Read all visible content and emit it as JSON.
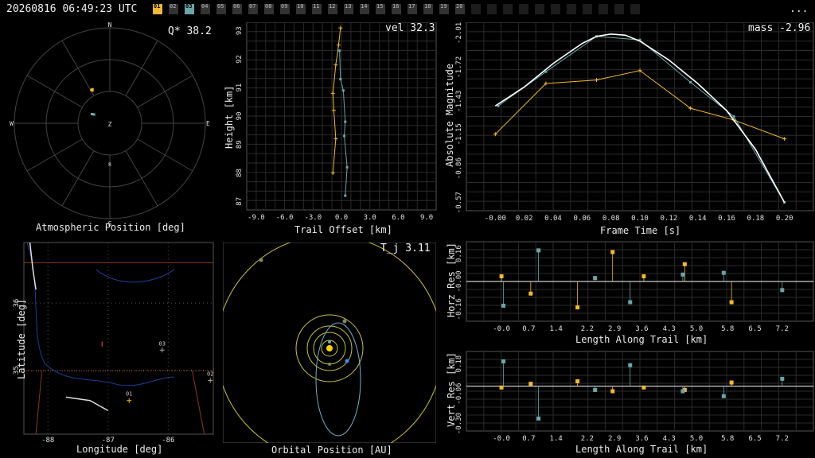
{
  "header": {
    "timestamp": "20260816 06:49:23 UTC",
    "more_label": "...",
    "stations": [
      {
        "id": "01",
        "color": "#f5b82e",
        "active": true
      },
      {
        "id": "02",
        "color": "#3a3a3a",
        "active": false
      },
      {
        "id": "03",
        "color": "#6aa6a8",
        "active": true
      },
      {
        "id": "04",
        "color": "#3a3a3a",
        "active": false
      },
      {
        "id": "05",
        "color": "#3a3a3a",
        "active": false
      },
      {
        "id": "06",
        "color": "#3a3a3a",
        "active": false
      },
      {
        "id": "07",
        "color": "#3a3a3a",
        "active": false
      },
      {
        "id": "08",
        "color": "#3a3a3a",
        "active": false
      },
      {
        "id": "09",
        "color": "#3a3a3a",
        "active": false
      },
      {
        "id": "10",
        "color": "#3a3a3a",
        "active": false
      },
      {
        "id": "11",
        "color": "#3a3a3a",
        "active": false
      },
      {
        "id": "12",
        "color": "#3a3a3a",
        "active": false
      },
      {
        "id": "13",
        "color": "#3a3a3a",
        "active": false
      },
      {
        "id": "14",
        "color": "#3a3a3a",
        "active": false
      },
      {
        "id": "15",
        "color": "#3a3a3a",
        "active": false
      },
      {
        "id": "16",
        "color": "#3a3a3a",
        "active": false
      },
      {
        "id": "17",
        "color": "#3a3a3a",
        "active": false
      },
      {
        "id": "18",
        "color": "#3a3a3a",
        "active": false
      },
      {
        "id": "19",
        "color": "#3a3a3a",
        "active": false
      },
      {
        "id": "20",
        "color": "#3a3a3a",
        "active": false
      },
      {
        "id": "",
        "color": "#1c1c1c",
        "active": false
      },
      {
        "id": "",
        "color": "#1c1c1c",
        "active": false
      },
      {
        "id": "",
        "color": "#1c1c1c",
        "active": false
      },
      {
        "id": "",
        "color": "#1c1c1c",
        "active": false
      },
      {
        "id": "",
        "color": "#1c1c1c",
        "active": false
      },
      {
        "id": "",
        "color": "#1c1c1c",
        "active": false
      },
      {
        "id": "",
        "color": "#1c1c1c",
        "active": false
      },
      {
        "id": "",
        "color": "#1c1c1c",
        "active": false
      },
      {
        "id": "",
        "color": "#1c1c1c",
        "active": false
      },
      {
        "id": "",
        "color": "#1c1c1c",
        "active": false
      },
      {
        "id": "",
        "color": "#1c1c1c",
        "active": false
      }
    ]
  },
  "colors": {
    "station1": "#f5b82e",
    "station2": "#6aa6a8",
    "fit": "#ffffff",
    "grid": "#2b2b2b",
    "orbit": "#c8c23a",
    "sun": "#ffd400",
    "earth": "#3a8cff",
    "comet_orbit": "#6fb3c9"
  },
  "chart_data": [
    {
      "type": "scatter",
      "name": "atmospheric_position",
      "title": "Atmospheric Position [deg]",
      "readout": "Q* 38.2",
      "compass": {
        "n": "N",
        "s": "S",
        "e": "E",
        "w": "W",
        "z": "Z",
        "r": "R"
      },
      "series": [
        {
          "station": "01",
          "points": [
            [
              -28,
              55
            ],
            [
              -29,
              54
            ],
            [
              -27,
              54
            ]
          ]
        },
        {
          "station": "03",
          "points": [
            [
              -62,
              72
            ],
            [
              -63,
              71
            ],
            [
              -61,
              73
            ]
          ]
        }
      ]
    },
    {
      "type": "line",
      "name": "trail",
      "title": "",
      "readout": "vel 32.3",
      "xlabel": "Trail Offset [km]",
      "ylabel": "Height [km]",
      "xlim": [
        -10,
        10
      ],
      "ylim": [
        86.7,
        93.3
      ],
      "xticks": [
        "-9.0",
        "-6.0",
        "-3.0",
        "0.0",
        "3.0",
        "6.0",
        "9.0"
      ],
      "yticks": [
        "87",
        "88",
        "89",
        "90",
        "91",
        "92",
        "93"
      ],
      "series": [
        {
          "station": "01",
          "x": [
            -0.1,
            -0.3,
            -0.6,
            -0.9,
            -0.8,
            -0.6,
            -0.9
          ],
          "y": [
            93.1,
            92.5,
            91.8,
            90.8,
            90.2,
            89.2,
            88.0
          ]
        },
        {
          "station": "03",
          "x": [
            -0.2,
            -0.1,
            0.2,
            0.4,
            0.3,
            0.6,
            0.4
          ],
          "y": [
            92.3,
            91.3,
            90.9,
            89.8,
            89.3,
            88.2,
            87.2
          ]
        }
      ]
    },
    {
      "type": "line",
      "name": "light_curve",
      "title": "",
      "readout": "mass -2.96",
      "xlabel": "Frame Time [s]",
      "ylabel": "Absolute Magnitude",
      "xlim": [
        -0.02,
        0.22
      ],
      "ylim": [
        -0.5,
        -2.1
      ],
      "xticks": [
        "-0.00",
        "0.02",
        "0.04",
        "0.06",
        "0.08",
        "0.10",
        "0.12",
        "0.14",
        "0.16",
        "0.18",
        "0.20"
      ],
      "yticks": [
        "-2.01",
        "-1.72",
        "-1.43",
        "-1.15",
        "-0.86",
        "-0.57"
      ],
      "series": [
        {
          "station": "01",
          "x": [
            0.0,
            0.035,
            0.07,
            0.1,
            0.135,
            0.165,
            0.2
          ],
          "y": [
            -1.15,
            -1.58,
            -1.61,
            -1.69,
            -1.37,
            -1.27,
            -1.11
          ]
        },
        {
          "station": "03",
          "x": [
            0.002,
            0.035,
            0.07,
            0.1,
            0.135,
            0.165,
            0.2
          ],
          "y": [
            -1.39,
            -1.68,
            -1.98,
            -1.95,
            -1.59,
            -1.3,
            -0.57
          ]
        },
        {
          "station": "fit",
          "x": [
            0.0,
            0.02,
            0.04,
            0.06,
            0.07,
            0.08,
            0.09,
            0.1,
            0.12,
            0.14,
            0.16,
            0.18,
            0.2
          ],
          "y": [
            -1.39,
            -1.55,
            -1.75,
            -1.92,
            -1.98,
            -2.0,
            -1.99,
            -1.94,
            -1.78,
            -1.58,
            -1.35,
            -1.02,
            -0.57
          ]
        }
      ]
    },
    {
      "type": "scatter",
      "name": "ground_map",
      "title": "",
      "xlabel": "Longitude [deg]",
      "ylabel": "Latitude [deg]",
      "xlim": [
        -88.4,
        -85.25
      ],
      "ylim": [
        34.05,
        36.9
      ],
      "xticks": [
        "-88",
        "-87",
        "-86"
      ],
      "yticks": [
        "35",
        "36"
      ],
      "stations": [
        {
          "id": "01",
          "lon": -86.65,
          "lat": 34.55
        },
        {
          "id": "03",
          "lon": -86.1,
          "lat": 35.3
        },
        {
          "id": "02",
          "lon": -85.3,
          "lat": 34.85
        }
      ],
      "trail": [
        {
          "lon": -87.1,
          "lat": 35.35
        },
        {
          "lon": -87.1,
          "lat": 35.38
        }
      ]
    },
    {
      "type": "scatter",
      "name": "orbit",
      "title": "Orbital Position [AU]",
      "readout": "T_j 3.11"
    },
    {
      "type": "scatter",
      "name": "horizontal_residuals",
      "title": "",
      "xlabel": "Length Along Trail [km]",
      "ylabel": "Horz Res [km]",
      "xlim": [
        -0.9,
        8.0
      ],
      "ylim": [
        -0.23,
        0.23
      ],
      "xticks": [
        "-0.0",
        "0.7",
        "1.4",
        "2.2",
        "2.9",
        "3.6",
        "4.3",
        "5.0",
        "5.8",
        "6.5",
        "7.2"
      ],
      "yticks": [
        "0.16",
        "-0.00",
        "-0.16"
      ],
      "series": [
        {
          "station": "01",
          "x": [
            0.0,
            0.75,
            1.95,
            2.85,
            3.65,
            4.7,
            5.9
          ],
          "y": [
            0.03,
            -0.07,
            -0.15,
            0.17,
            0.03,
            0.1,
            -0.12
          ]
        },
        {
          "station": "03",
          "x": [
            0.05,
            0.95,
            2.4,
            3.3,
            4.65,
            5.7,
            7.2
          ],
          "y": [
            -0.14,
            0.18,
            0.02,
            -0.12,
            0.04,
            0.05,
            -0.05
          ]
        }
      ]
    },
    {
      "type": "scatter",
      "name": "vertical_residuals",
      "title": "",
      "xlabel": "Length Along Trail [km]",
      "ylabel": "Vert Res [km]",
      "xlim": [
        -0.9,
        8.0
      ],
      "ylim": [
        -0.36,
        0.28
      ],
      "xticks": [
        "-0.0",
        "0.7",
        "1.4",
        "2.2",
        "2.9",
        "3.6",
        "4.3",
        "5.0",
        "5.8",
        "6.5",
        "7.2"
      ],
      "yticks": [
        "0.18",
        "-0.06",
        "-0.30"
      ],
      "series": [
        {
          "station": "01",
          "x": [
            0.0,
            0.75,
            1.95,
            2.85,
            3.65,
            4.7,
            5.9
          ],
          "y": [
            -0.01,
            0.02,
            0.04,
            -0.04,
            -0.01,
            -0.03,
            0.03
          ],
          "dual": true
        },
        {
          "station": "03",
          "x": [
            0.05,
            0.95,
            2.4,
            3.3,
            4.65,
            5.7,
            7.2
          ],
          "y": [
            0.2,
            -0.26,
            -0.03,
            0.17,
            -0.04,
            -0.08,
            0.06
          ]
        }
      ]
    }
  ]
}
